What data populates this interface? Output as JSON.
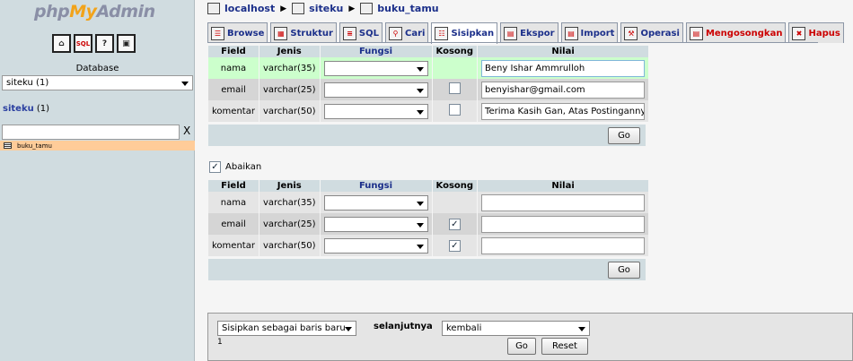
{
  "left": {
    "logo_php": "php",
    "logo_my": "My",
    "logo_admin": "Admin",
    "nav_icons": [
      "home-icon",
      "sql-icon",
      "help-icon",
      "query-window-icon"
    ],
    "nav_sql_label": "SQL",
    "database_label": "Database",
    "database_select": "siteku (1)",
    "db_name": "siteku",
    "db_count": "(1)",
    "filter_clear": "X",
    "tables": [
      "buku_tamu"
    ]
  },
  "breadcrumb": {
    "server": "localhost",
    "database": "siteku",
    "table": "buku_tamu"
  },
  "tabs": [
    {
      "label": "Browse",
      "icon": "browse-icon"
    },
    {
      "label": "Struktur",
      "icon": "structure-icon"
    },
    {
      "label": "SQL",
      "icon": "sql-icon"
    },
    {
      "label": "Cari",
      "icon": "search-icon"
    },
    {
      "label": "Sisipkan",
      "icon": "insert-icon",
      "active": true
    },
    {
      "label": "Ekspor",
      "icon": "export-icon"
    },
    {
      "label": "Import",
      "icon": "import-icon"
    },
    {
      "label": "Operasi",
      "icon": "operations-icon"
    },
    {
      "label": "Mengosongkan",
      "icon": "empty-icon",
      "danger": true
    },
    {
      "label": "Hapus",
      "icon": "drop-icon",
      "danger": true
    }
  ],
  "columns": {
    "field": "Field",
    "type": "Jenis",
    "function": "Fungsi",
    "null": "Kosong",
    "value": "Nilai"
  },
  "form1": {
    "rows": [
      {
        "field": "nama",
        "type": "varchar(35)",
        "null_checkbox": false,
        "null_checked": false,
        "value": "Beny Ishar Ammrulloh"
      },
      {
        "field": "email",
        "type": "varchar(25)",
        "null_checkbox": true,
        "null_checked": false,
        "value": "benyishar@gmail.com"
      },
      {
        "field": "komentar",
        "type": "varchar(50)",
        "null_checkbox": true,
        "null_checked": false,
        "value": "Terima Kasih Gan, Atas Postingannya"
      }
    ],
    "go_label": "Go"
  },
  "ignore": {
    "label": "Abaikan",
    "checked": true
  },
  "form2": {
    "rows": [
      {
        "field": "nama",
        "type": "varchar(35)",
        "null_checkbox": false,
        "null_checked": false,
        "value": ""
      },
      {
        "field": "email",
        "type": "varchar(25)",
        "null_checkbox": true,
        "null_checked": true,
        "value": ""
      },
      {
        "field": "komentar",
        "type": "varchar(50)",
        "null_checkbox": true,
        "null_checked": true,
        "value": ""
      }
    ],
    "go_label": "Go"
  },
  "footer": {
    "insert_mode": "Sisipkan sebagai baris baru",
    "next_label": "selanjutnya",
    "after_insert": "kembali",
    "tab_index": "1",
    "go_label": "Go",
    "reset_label": "Reset"
  },
  "colors": {
    "left_bg": "#d0dce0",
    "highlight_row": "#ccffcc",
    "selected_table": "#ffcc99",
    "link": "#1b2f8a",
    "danger": "#cc0000"
  }
}
